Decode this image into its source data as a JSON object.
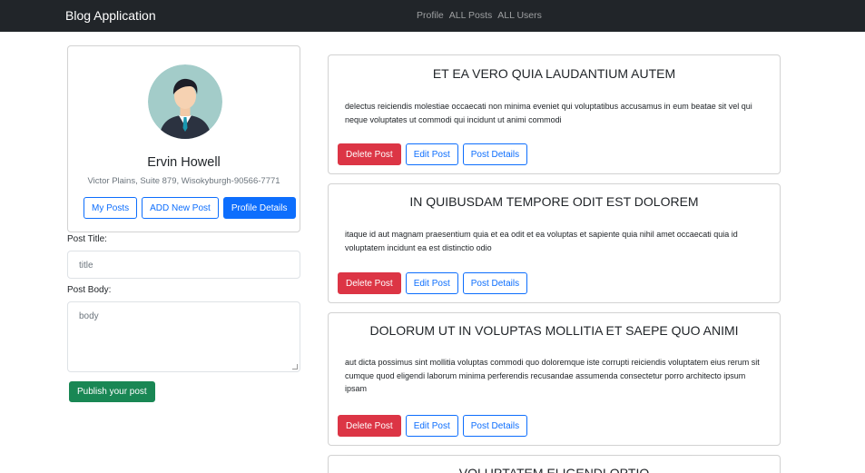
{
  "navbar": {
    "brand": "Blog Application",
    "links": [
      "Profile",
      "ALL Posts",
      "ALL Users"
    ]
  },
  "profile": {
    "name": "Ervin Howell",
    "address": "Victor Plains, Suite 879, Wisokyburgh-90566-7771",
    "buttons": {
      "my_posts": "My Posts",
      "add_new_post": "ADD New Post",
      "profile_details": "Profile Details"
    }
  },
  "form": {
    "title_label": "Post Title:",
    "title_placeholder": "title",
    "body_label": "Post Body:",
    "body_placeholder": "body",
    "publish_label": "Publish your post"
  },
  "posts": [
    {
      "title": "ET EA VERO QUIA LAUDANTIUM AUTEM",
      "body": "delectus reiciendis molestiae occaecati non minima eveniet qui voluptatibus accusamus in eum beatae sit vel qui neque voluptates ut commodi qui incidunt ut animi commodi",
      "delete_label": "Delete Post",
      "edit_label": "Edit Post",
      "details_label": "Post Details"
    },
    {
      "title": "IN QUIBUSDAM TEMPORE ODIT EST DOLOREM",
      "body": "itaque id aut magnam praesentium quia et ea odit et ea voluptas et sapiente quia nihil amet occaecati quia id voluptatem incidunt ea est distinctio odio",
      "delete_label": "Delete Post",
      "edit_label": "Edit Post",
      "details_label": "Post Details"
    },
    {
      "title": "DOLORUM UT IN VOLUPTAS MOLLITIA ET SAEPE QUO ANIMI",
      "body": "aut dicta possimus sint mollitia voluptas commodi quo doloremque iste corrupti reiciendis voluptatem eius rerum sit cumque quod eligendi laborum minima perferendis recusandae assumenda consectetur porro architecto ipsum ipsam",
      "delete_label": "Delete Post",
      "edit_label": "Edit Post",
      "details_label": "Post Details"
    },
    {
      "title": "VOLUPTATEM ELIGENDI OPTIO"
    }
  ],
  "colors": {
    "navbar_bg": "#212529",
    "primary": "#0d6efd",
    "danger": "#dc3545",
    "success": "#198754"
  },
  "icons": {
    "avatar": "user-avatar-icon"
  }
}
